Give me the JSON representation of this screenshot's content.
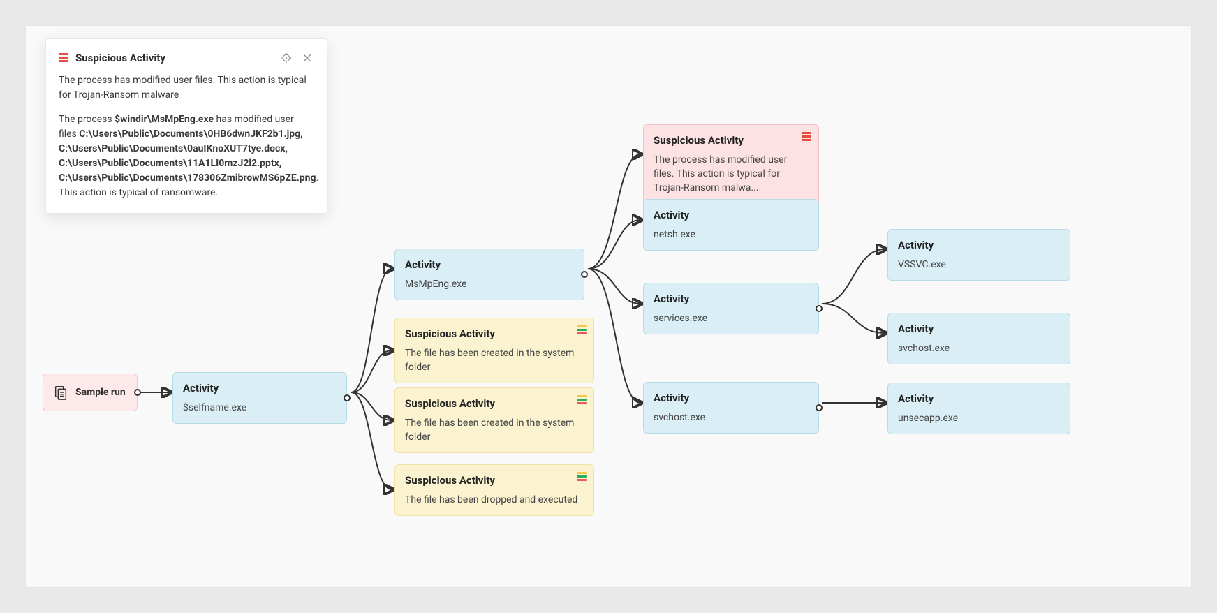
{
  "panel": {
    "title": "Suspicious Activity",
    "desc": "The process has modified user files. This action is typical for Trojan-Ransom malware",
    "line1_pre": "The process ",
    "line1_bold": "$windir\\MsMpEng.exe",
    "line1_post": " has modified user files ",
    "files_bold": "C:\\Users\\Public\\Documents\\0HB6dwnJKF2b1.jpg, C:\\Users\\Public\\Documents\\0auIKnoXUT7tye.docx, C:\\Users\\Public\\Documents\\11A1LI0mzJ2l2.pptx, C:\\Users\\Public\\Documents\\178306ZmibrowMS6pZE.png",
    "tail": ". This action is typical of ransomware."
  },
  "nodes": {
    "root": {
      "label": "Sample run"
    },
    "a1": {
      "title": "Activity",
      "sub": "$selfname.exe"
    },
    "b1": {
      "title": "Activity",
      "sub": "MsMpEng.exe"
    },
    "b2": {
      "title": "Suspicious Activity",
      "sub": "The file has been created in the system folder"
    },
    "b3": {
      "title": "Suspicious Activity",
      "sub": "The file has been created in the system folder"
    },
    "b4": {
      "title": "Suspicious Activity",
      "sub": "The file has been dropped and executed"
    },
    "c1": {
      "title": "Suspicious Activity",
      "sub": "The process has modified user files. This action is typical for Trojan-Ransom malwa..."
    },
    "c2": {
      "title": "Activity",
      "sub": "netsh.exe"
    },
    "c3": {
      "title": "Activity",
      "sub": "services.exe"
    },
    "c4": {
      "title": "Activity",
      "sub": "svchost.exe"
    },
    "d1": {
      "title": "Activity",
      "sub": "VSSVC.exe"
    },
    "d2": {
      "title": "Activity",
      "sub": "svchost.exe"
    },
    "d3": {
      "title": "Activity",
      "sub": "unsecapp.exe"
    }
  }
}
